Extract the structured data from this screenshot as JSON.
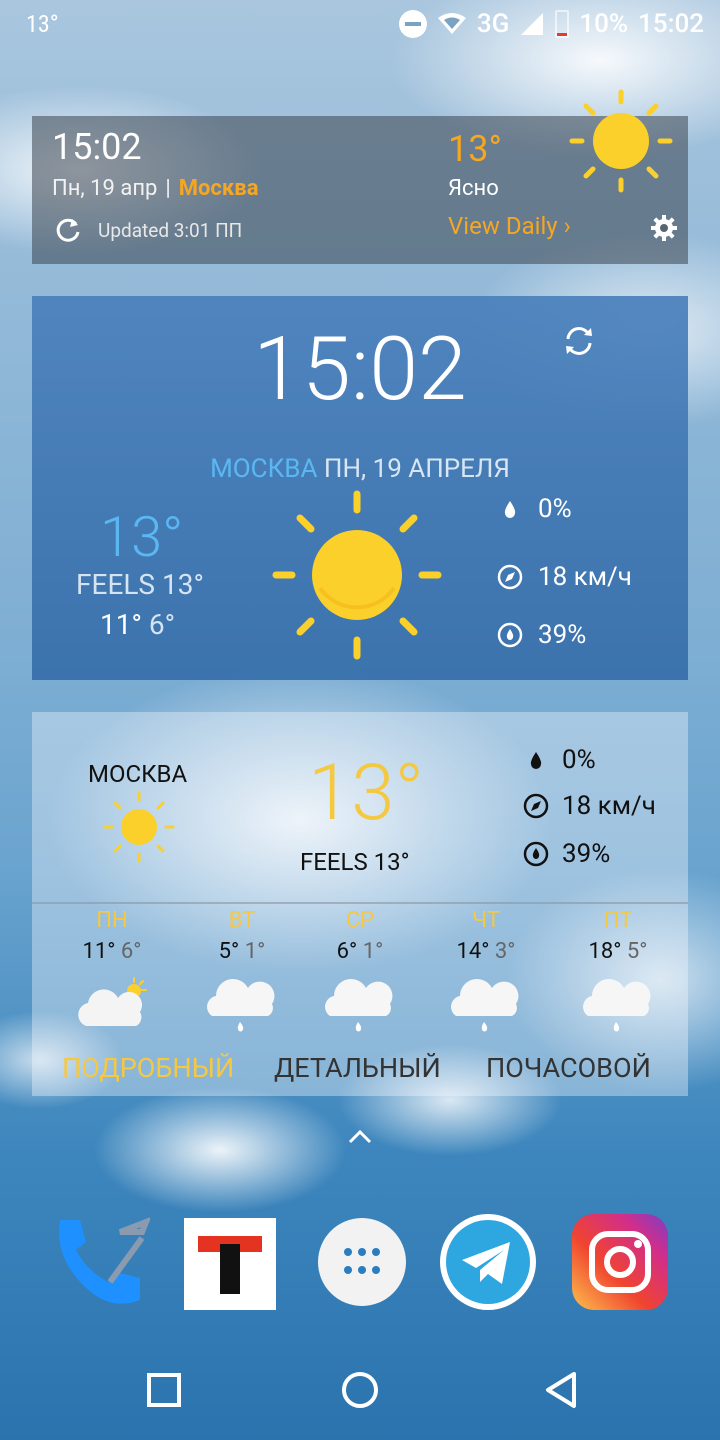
{
  "status_bar": {
    "temp": "13°",
    "network": "3G",
    "battery": "10%",
    "time": "15:02"
  },
  "widget_top": {
    "time": "15:02",
    "date": "Пн, 19 апр",
    "separator": "|",
    "city": "Москва",
    "updated": "Updated 3:01 ПП",
    "temp": "13°",
    "condition": "Ясно",
    "view_daily": "View Daily ›"
  },
  "widget_clock": {
    "time": "15:02",
    "city": "МОСКВА",
    "date": "ПН, 19 АПРЕЛЯ",
    "temp": "13°",
    "feels": "FEELS 13°",
    "high": "11°",
    "low": "6°",
    "precip": "0%",
    "wind": "18 км/ч",
    "humidity": "39%"
  },
  "widget_forecast": {
    "city": "МОСКВА",
    "temp": "13°",
    "feels": "FEELS 13°",
    "precip": "0%",
    "wind": "18 км/ч",
    "humidity": "39%",
    "days": [
      {
        "name": "ПН",
        "high": "11°",
        "low": "6°",
        "icon": "partly-cloudy-icon"
      },
      {
        "name": "ВТ",
        "high": "5°",
        "low": "1°",
        "icon": "rain-cloud-icon"
      },
      {
        "name": "СР",
        "high": "6°",
        "low": "1°",
        "icon": "rain-cloud-icon"
      },
      {
        "name": "ЧТ",
        "high": "14°",
        "low": "3°",
        "icon": "rain-cloud-icon"
      },
      {
        "name": "ПТ",
        "high": "18°",
        "low": "5°",
        "icon": "rain-cloud-icon"
      }
    ],
    "tabs": [
      "ПОДРОБНЫЙ",
      "ДЕТАЛЬНЫЙ",
      "ПОЧАСОВОЙ"
    ]
  },
  "dock": {
    "apps": [
      "phone-app-icon",
      "tj-app-icon",
      "app-drawer-icon",
      "telegram-app-icon",
      "instagram-app-icon"
    ]
  },
  "colors": {
    "accent": "#f5a623",
    "sun": "#fcd02a",
    "city_blue": "#5bb7f2"
  }
}
